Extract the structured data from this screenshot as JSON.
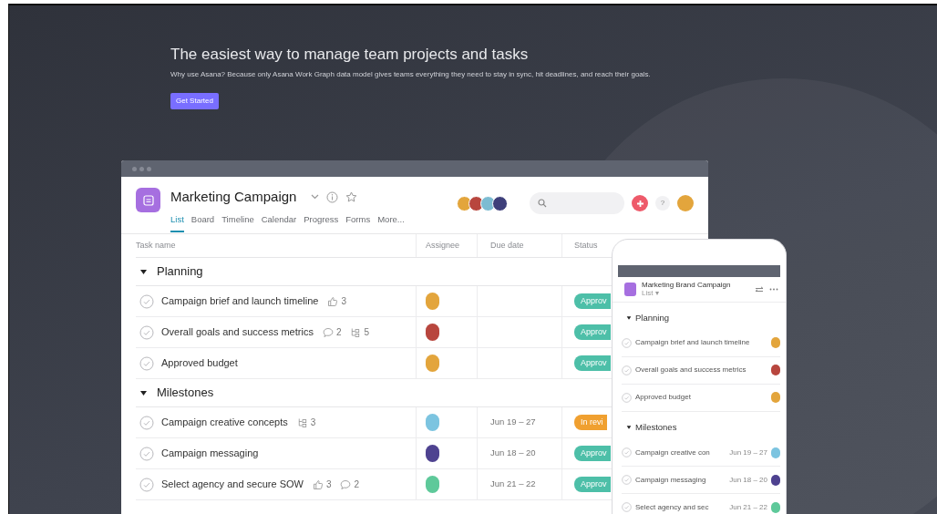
{
  "hero": {
    "title": "The easiest way to manage team projects and tasks",
    "subtitle": "Why use Asana? Because only Asana Work Graph data model gives teams everything they need to stay in sync, hit deadlines, and reach their goals.",
    "button": "Get Started"
  },
  "app": {
    "project_title": "Marketing Campaign",
    "tabs": [
      {
        "label": "List",
        "selected": true
      },
      {
        "label": "Board",
        "selected": false
      },
      {
        "label": "Timeline",
        "selected": false
      },
      {
        "label": "Calendar",
        "selected": false
      },
      {
        "label": "Progress",
        "selected": false
      },
      {
        "label": "Forms",
        "selected": false
      },
      {
        "label": "More...",
        "selected": false
      }
    ],
    "members": [
      {
        "color": "#e3a53c"
      },
      {
        "color": "#b8463e"
      },
      {
        "color": "#7cbcd2"
      },
      {
        "color": "#3e3f7a"
      }
    ],
    "help_label": "?",
    "user_avatar": {
      "color": "#e3a53c"
    },
    "columns": [
      "Task name",
      "Assignee",
      "Due date",
      "Status"
    ],
    "sections": [
      {
        "name": "Planning",
        "expanded": true,
        "tasks": [
          {
            "name": "Campaign brief and launch timeline",
            "completed": false,
            "meta": [
              {
                "kind": "likes",
                "count": "3"
              }
            ],
            "assignee": {
              "color": "#e3a53c"
            },
            "status": {
              "label": "Approv",
              "color": "#4dbfa8"
            }
          },
          {
            "name": "Overall goals and success metrics",
            "completed": false,
            "meta": [
              {
                "kind": "comments",
                "count": "2"
              },
              {
                "kind": "subtasks",
                "count": "5"
              }
            ],
            "assignee": {
              "color": "#b8463e"
            },
            "status": {
              "label": "Approv",
              "color": "#4dbfa8"
            }
          },
          {
            "name": "Approved budget",
            "completed": false,
            "assignee": {
              "color": "#e3a53c"
            },
            "status": {
              "label": "Approv",
              "color": "#4dbfa8"
            }
          }
        ]
      },
      {
        "name": "Milestones",
        "expanded": true,
        "tasks": [
          {
            "name": "Campaign creative concepts",
            "completed": false,
            "meta": [
              {
                "kind": "subtasks",
                "count": "3"
              }
            ],
            "assignee": {
              "color": "#7cc4e0"
            },
            "due": "Jun 19 – 27",
            "status": {
              "label": "In revi",
              "color": "#f0a030"
            }
          },
          {
            "name": "Campaign messaging",
            "completed": false,
            "assignee": {
              "color": "#4e4290"
            },
            "due": "Jun 18 – 20",
            "status": {
              "label": "Approv",
              "color": "#4dbfa8"
            }
          },
          {
            "name": "Select agency and secure SOW",
            "completed": false,
            "meta": [
              {
                "kind": "likes",
                "count": "3"
              },
              {
                "kind": "comments",
                "count": "2"
              }
            ],
            "assignee": {
              "color": "#5ec99a"
            },
            "due": "Jun 21 – 22",
            "status": {
              "label": "Approv",
              "color": "#4dbfa8"
            }
          }
        ]
      }
    ]
  },
  "phone": {
    "project_title": "Marketing Brand Campaign",
    "view_label": "List ▾",
    "sections": [
      {
        "name": "Planning",
        "expanded": true,
        "tasks": [
          {
            "name": "Campaign brief and launch timeline",
            "completed": false,
            "assignee": {
              "color": "#e3a53c"
            }
          },
          {
            "name": "Overall goals and success metrics",
            "completed": false,
            "assignee": {
              "color": "#b8463e"
            }
          },
          {
            "name": "Approved budget",
            "completed": false,
            "assignee": {
              "color": "#e3a53c"
            }
          }
        ]
      },
      {
        "name": "Milestones",
        "expanded": true,
        "tasks": [
          {
            "name": "Campaign creative con",
            "completed": false,
            "due": "Jun 19 – 27",
            "assignee": {
              "color": "#7cc4e0"
            }
          },
          {
            "name": "Campaign messaging",
            "completed": false,
            "due": "Jun 18 – 20",
            "assignee": {
              "color": "#4e4290"
            }
          },
          {
            "name": "Select agency and sec",
            "completed": false,
            "due": "Jun 21 – 22",
            "assignee": {
              "color": "#5ec99a"
            }
          }
        ]
      }
    ]
  }
}
